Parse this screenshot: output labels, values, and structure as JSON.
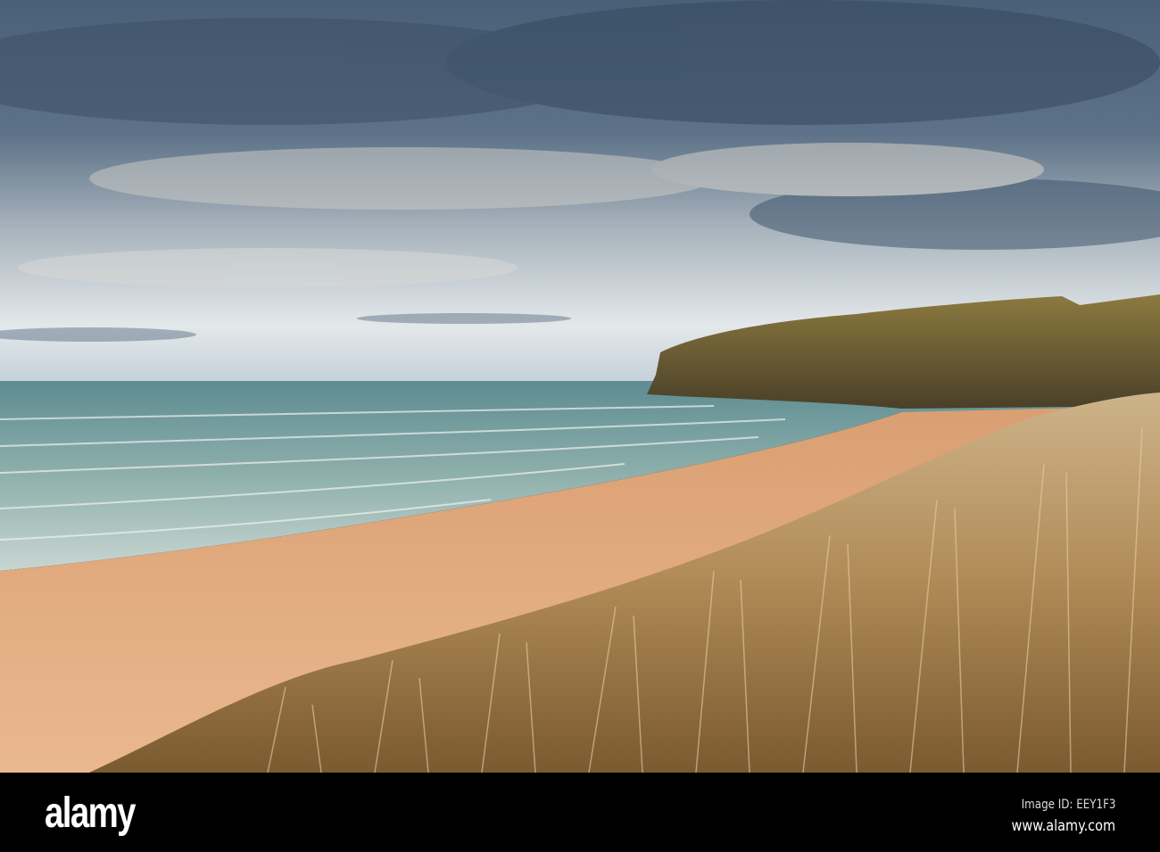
{
  "photo": {
    "subject": "beach",
    "colors": {
      "sky_top": "#3e5874",
      "sky_horizon": "#dfe6ea",
      "sea": "#6f9a98",
      "sand": "#e2ae84",
      "grass": "#b08a56",
      "cliff": "#7a6a35"
    }
  },
  "watermark": {
    "logo": "alamy",
    "image_id": "Image ID: EEY1F3",
    "url": "www.alamy.com"
  }
}
